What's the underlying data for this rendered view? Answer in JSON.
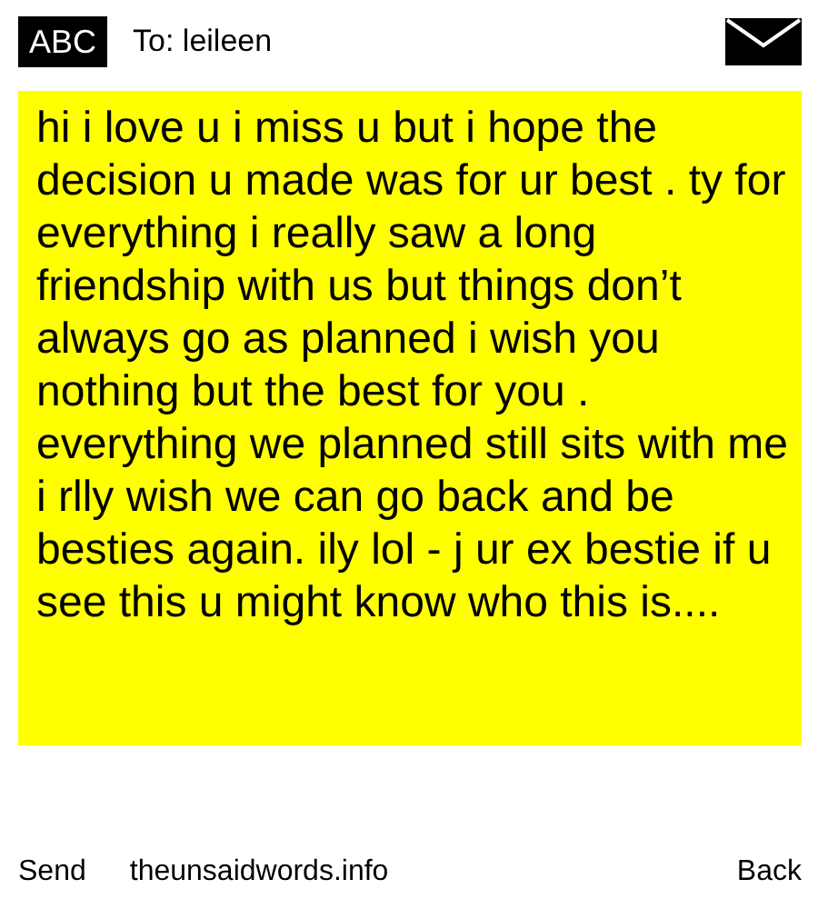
{
  "header": {
    "badge": "ABC",
    "recipient": "To: leileen"
  },
  "message": {
    "text": "hi i love u i miss u but i hope the decision u made was for ur best . ty for everything i really saw a long friendship with us but things don’t always go as planned i wish you nothing but the best for you . everything we planned still sits with me i rlly wish we can go back and be besties again. ily lol - j ur ex bestie if u see this u might know who this is...."
  },
  "footer": {
    "send": "Send",
    "site": "theunsaidwords.info",
    "back": "Back"
  }
}
